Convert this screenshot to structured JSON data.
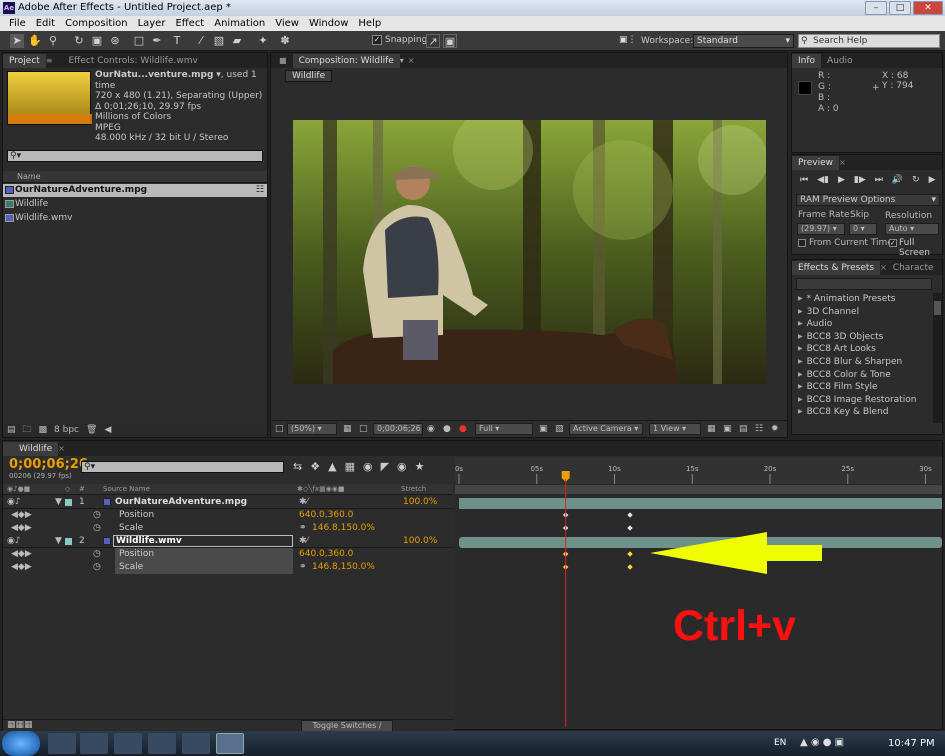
{
  "window": {
    "title": "Adobe After Effects - Untitled Project.aep *",
    "app_badge": "Ae"
  },
  "menu": [
    "File",
    "Edit",
    "Composition",
    "Layer",
    "Effect",
    "Animation",
    "View",
    "Window",
    "Help"
  ],
  "toolbar": {
    "snapping_label": "Snapping",
    "workspace_label": "Workspace:",
    "workspace_value": "Standard",
    "search_help_placeholder": "Search Help"
  },
  "project_panel": {
    "tabs": [
      "Project",
      "Effect Controls: Wildlife.wmv"
    ],
    "footage_name": "OurNatu...venture.mpg",
    "footage_used": ", used 1 time",
    "info_lines": [
      "720 x 480 (1.21), Separating (Upper)",
      "Δ 0;01;26;10, 29.97 fps",
      "Millions of Colors",
      "MPEG",
      "48.000 kHz / 32 bit U / Stereo"
    ],
    "search_placeholder": "",
    "column_name": "Name",
    "items": [
      "OurNatureAdventure.mpg",
      "Wildlife",
      "Wildlife.wmv"
    ],
    "bpc": "8 bpc"
  },
  "comp_panel": {
    "tab": "Composition: Wildlife",
    "breadcrumb": "Wildlife",
    "zoom": "(50%)",
    "timecode": "0;00;06;26",
    "resolution": "Full",
    "camera": "Active Camera",
    "view": "1 View"
  },
  "info_panel": {
    "tabs": [
      "Info",
      "Audio"
    ],
    "rgba_labels": [
      "R :",
      "G :",
      "B :",
      "A : 0"
    ],
    "x": "X : 68",
    "y": "Y : 794"
  },
  "preview_panel": {
    "tab": "Preview",
    "ram_options": "RAM Preview Options",
    "frame_rate_label": "Frame Rate",
    "skip_label": "Skip",
    "resolution_label": "Resolution",
    "frame_rate": "(29.97)",
    "skip": "0",
    "resolution": "Auto",
    "from_current": "From Current Time",
    "full_screen": "Full Screen"
  },
  "effects_panel": {
    "tabs": [
      "Effects & Presets",
      "Characte"
    ],
    "items": [
      "* Animation Presets",
      "3D Channel",
      "Audio",
      "BCC8 3D Objects",
      "BCC8 Art Looks",
      "BCC8 Blur & Sharpen",
      "BCC8 Color & Tone",
      "BCC8 Film Style",
      "BCC8 Image Restoration",
      "BCC8 Key & Blend"
    ]
  },
  "timeline": {
    "tab": "Wildlife",
    "timecode": "0;00;06;26",
    "frame_info": "00206 (29.97 fps)",
    "col_hash": "#",
    "col_source": "Source Name",
    "col_stretch": "Stretch",
    "ruler": [
      "0s",
      "05s",
      "10s",
      "15s",
      "20s",
      "25s",
      "30s"
    ],
    "layers": [
      {
        "num": "1",
        "name": "OurNatureAdventure.mpg",
        "stretch": "100.0%",
        "position": "640.0,360.0",
        "scale": "146.8,150.0%"
      },
      {
        "num": "2",
        "name": "Wildlife.wmv",
        "stretch": "100.0%",
        "position": "640.0,360.0",
        "scale": "146.8,150.0%"
      }
    ],
    "prop_position": "Position",
    "prop_scale": "Scale",
    "toggle_label": "Toggle Switches / Modes",
    "playhead_seconds": 6.86,
    "keyframes_seconds": [
      6.86,
      11.0
    ],
    "annotation": "Ctrl+v"
  },
  "taskbar": {
    "lang": "EN",
    "clock": "10:47 PM"
  },
  "colors": {
    "accent_orange": "#e8a000",
    "playhead": "#e02020",
    "annotation_red": "#ff1010",
    "arrow_yellow": "#f0ff00",
    "layer_bar": "#6f918b"
  }
}
